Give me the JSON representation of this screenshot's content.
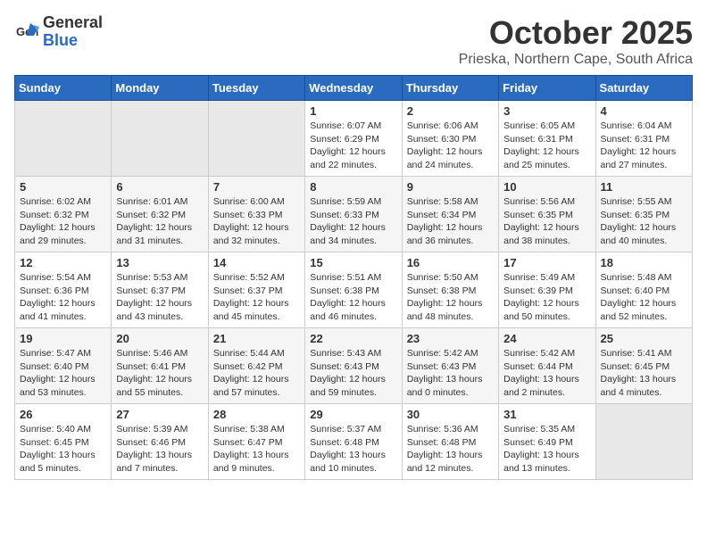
{
  "logo": {
    "general": "General",
    "blue": "Blue"
  },
  "title": "October 2025",
  "location": "Prieska, Northern Cape, South Africa",
  "days_of_week": [
    "Sunday",
    "Monday",
    "Tuesday",
    "Wednesday",
    "Thursday",
    "Friday",
    "Saturday"
  ],
  "weeks": [
    [
      {
        "day": "",
        "info": ""
      },
      {
        "day": "",
        "info": ""
      },
      {
        "day": "",
        "info": ""
      },
      {
        "day": "1",
        "info": "Sunrise: 6:07 AM\nSunset: 6:29 PM\nDaylight: 12 hours\nand 22 minutes."
      },
      {
        "day": "2",
        "info": "Sunrise: 6:06 AM\nSunset: 6:30 PM\nDaylight: 12 hours\nand 24 minutes."
      },
      {
        "day": "3",
        "info": "Sunrise: 6:05 AM\nSunset: 6:31 PM\nDaylight: 12 hours\nand 25 minutes."
      },
      {
        "day": "4",
        "info": "Sunrise: 6:04 AM\nSunset: 6:31 PM\nDaylight: 12 hours\nand 27 minutes."
      }
    ],
    [
      {
        "day": "5",
        "info": "Sunrise: 6:02 AM\nSunset: 6:32 PM\nDaylight: 12 hours\nand 29 minutes."
      },
      {
        "day": "6",
        "info": "Sunrise: 6:01 AM\nSunset: 6:32 PM\nDaylight: 12 hours\nand 31 minutes."
      },
      {
        "day": "7",
        "info": "Sunrise: 6:00 AM\nSunset: 6:33 PM\nDaylight: 12 hours\nand 32 minutes."
      },
      {
        "day": "8",
        "info": "Sunrise: 5:59 AM\nSunset: 6:33 PM\nDaylight: 12 hours\nand 34 minutes."
      },
      {
        "day": "9",
        "info": "Sunrise: 5:58 AM\nSunset: 6:34 PM\nDaylight: 12 hours\nand 36 minutes."
      },
      {
        "day": "10",
        "info": "Sunrise: 5:56 AM\nSunset: 6:35 PM\nDaylight: 12 hours\nand 38 minutes."
      },
      {
        "day": "11",
        "info": "Sunrise: 5:55 AM\nSunset: 6:35 PM\nDaylight: 12 hours\nand 40 minutes."
      }
    ],
    [
      {
        "day": "12",
        "info": "Sunrise: 5:54 AM\nSunset: 6:36 PM\nDaylight: 12 hours\nand 41 minutes."
      },
      {
        "day": "13",
        "info": "Sunrise: 5:53 AM\nSunset: 6:37 PM\nDaylight: 12 hours\nand 43 minutes."
      },
      {
        "day": "14",
        "info": "Sunrise: 5:52 AM\nSunset: 6:37 PM\nDaylight: 12 hours\nand 45 minutes."
      },
      {
        "day": "15",
        "info": "Sunrise: 5:51 AM\nSunset: 6:38 PM\nDaylight: 12 hours\nand 46 minutes."
      },
      {
        "day": "16",
        "info": "Sunrise: 5:50 AM\nSunset: 6:38 PM\nDaylight: 12 hours\nand 48 minutes."
      },
      {
        "day": "17",
        "info": "Sunrise: 5:49 AM\nSunset: 6:39 PM\nDaylight: 12 hours\nand 50 minutes."
      },
      {
        "day": "18",
        "info": "Sunrise: 5:48 AM\nSunset: 6:40 PM\nDaylight: 12 hours\nand 52 minutes."
      }
    ],
    [
      {
        "day": "19",
        "info": "Sunrise: 5:47 AM\nSunset: 6:40 PM\nDaylight: 12 hours\nand 53 minutes."
      },
      {
        "day": "20",
        "info": "Sunrise: 5:46 AM\nSunset: 6:41 PM\nDaylight: 12 hours\nand 55 minutes."
      },
      {
        "day": "21",
        "info": "Sunrise: 5:44 AM\nSunset: 6:42 PM\nDaylight: 12 hours\nand 57 minutes."
      },
      {
        "day": "22",
        "info": "Sunrise: 5:43 AM\nSunset: 6:43 PM\nDaylight: 12 hours\nand 59 minutes."
      },
      {
        "day": "23",
        "info": "Sunrise: 5:42 AM\nSunset: 6:43 PM\nDaylight: 13 hours\nand 0 minutes."
      },
      {
        "day": "24",
        "info": "Sunrise: 5:42 AM\nSunset: 6:44 PM\nDaylight: 13 hours\nand 2 minutes."
      },
      {
        "day": "25",
        "info": "Sunrise: 5:41 AM\nSunset: 6:45 PM\nDaylight: 13 hours\nand 4 minutes."
      }
    ],
    [
      {
        "day": "26",
        "info": "Sunrise: 5:40 AM\nSunset: 6:45 PM\nDaylight: 13 hours\nand 5 minutes."
      },
      {
        "day": "27",
        "info": "Sunrise: 5:39 AM\nSunset: 6:46 PM\nDaylight: 13 hours\nand 7 minutes."
      },
      {
        "day": "28",
        "info": "Sunrise: 5:38 AM\nSunset: 6:47 PM\nDaylight: 13 hours\nand 9 minutes."
      },
      {
        "day": "29",
        "info": "Sunrise: 5:37 AM\nSunset: 6:48 PM\nDaylight: 13 hours\nand 10 minutes."
      },
      {
        "day": "30",
        "info": "Sunrise: 5:36 AM\nSunset: 6:48 PM\nDaylight: 13 hours\nand 12 minutes."
      },
      {
        "day": "31",
        "info": "Sunrise: 5:35 AM\nSunset: 6:49 PM\nDaylight: 13 hours\nand 13 minutes."
      },
      {
        "day": "",
        "info": ""
      }
    ]
  ]
}
